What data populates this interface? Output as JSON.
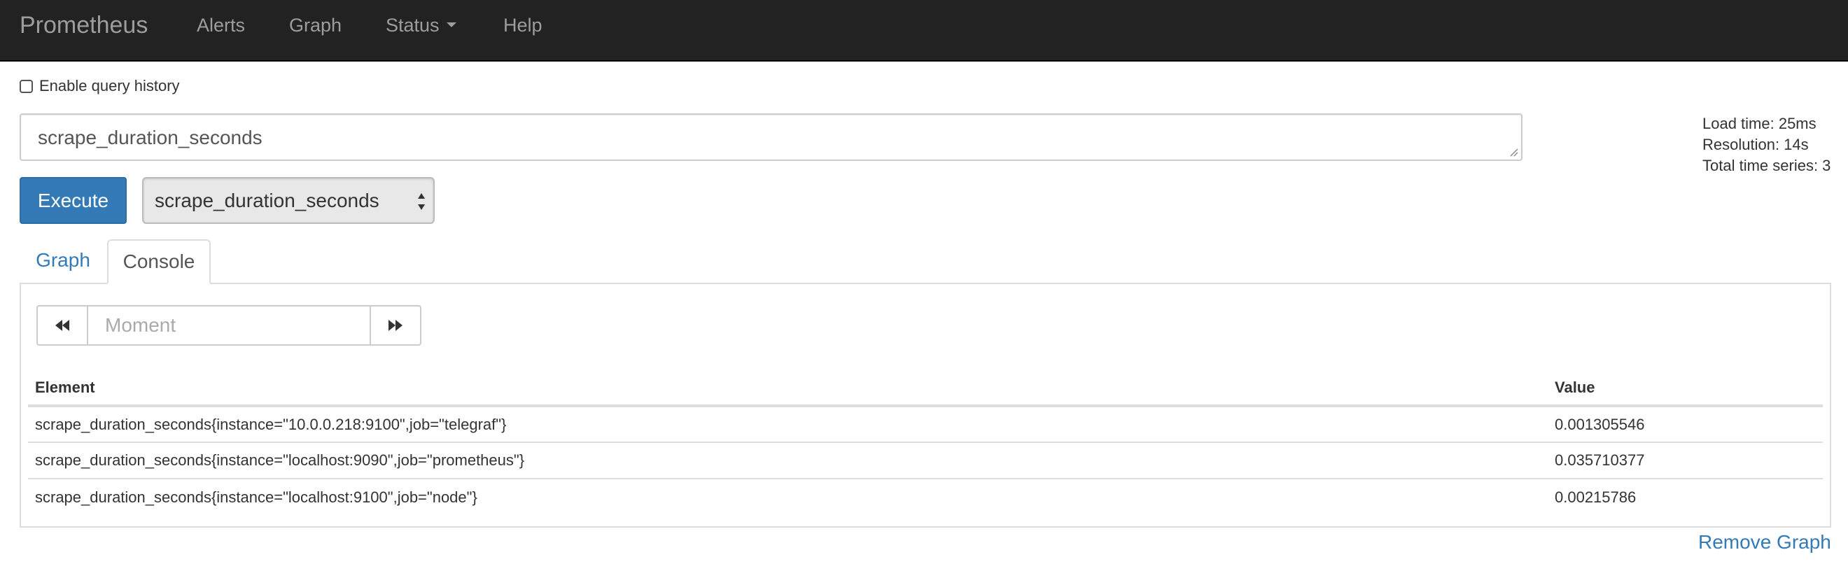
{
  "navbar": {
    "brand": "Prometheus",
    "items": [
      {
        "label": "Alerts"
      },
      {
        "label": "Graph"
      },
      {
        "label": "Status",
        "icon": "caret-down-icon"
      },
      {
        "label": "Help"
      }
    ]
  },
  "history": {
    "checked": false,
    "label": "Enable query history"
  },
  "query": {
    "value": "scrape_duration_seconds"
  },
  "stats": {
    "load_time": "Load time: 25ms",
    "resolution": "Resolution: 14s",
    "total_series": "Total time series: 3"
  },
  "actions": {
    "execute_label": "Execute",
    "metric_select_value": "scrape_duration_seconds"
  },
  "tabs": [
    {
      "label": "Graph",
      "active": false
    },
    {
      "label": "Console",
      "active": true
    }
  ],
  "console": {
    "moment_placeholder": "Moment",
    "prev_icon": "backward-icon",
    "next_icon": "forward-icon",
    "columns": {
      "element": "Element",
      "value": "Value"
    },
    "rows": [
      {
        "element": "scrape_duration_seconds{instance=\"10.0.0.218:9100\",job=\"telegraf\"}",
        "value": "0.001305546"
      },
      {
        "element": "scrape_duration_seconds{instance=\"localhost:9090\",job=\"prometheus\"}",
        "value": "0.035710377"
      },
      {
        "element": "scrape_duration_seconds{instance=\"localhost:9100\",job=\"node\"}",
        "value": "0.00215786"
      }
    ]
  },
  "remove_graph_label": "Remove Graph",
  "colors": {
    "navbar_bg": "#222222",
    "nav_text": "#9d9d9d",
    "primary": "#337ab7",
    "border": "#dddddd"
  }
}
